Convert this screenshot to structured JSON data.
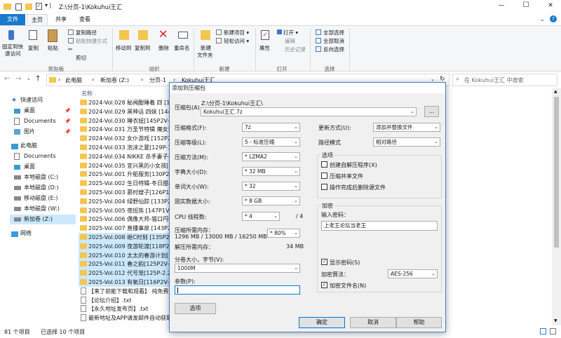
{
  "window": {
    "title": "Z:\\分页-1\\Kokuhui王汇",
    "minimize": "—",
    "maximize": "☐",
    "close": "✕"
  },
  "tabs": [
    {
      "label": "文件"
    },
    {
      "label": "主页"
    },
    {
      "label": "共享"
    },
    {
      "label": "查看"
    }
  ],
  "ribbon": {
    "pin_label_1": "固定到快",
    "pin_label_2": "速访问",
    "copy": "复制",
    "paste": "粘贴",
    "copy_path": "复制路径",
    "paste_shortcut": "粘贴快捷方式",
    "cut": "剪切",
    "move_to": "移动到",
    "copy_to": "复制到",
    "delete": "删除",
    "rename": "重命名",
    "new_folder_1": "新建",
    "new_folder_2": "文件夹",
    "new_item": "新建项目 ▾",
    "easy_access": "轻松访问 ▾",
    "properties": "属性",
    "open": "打开 ▾",
    "edit": "编辑",
    "history": "历史记录",
    "select_all": "全部选择",
    "select_none": "全部取消",
    "invert": "反向选择",
    "groups": {
      "clipboard": "剪贴板",
      "organize": "组织",
      "new": "新建",
      "open": "打开",
      "select": "选择"
    }
  },
  "address": {
    "crumbs": [
      "此电脑",
      "新加卷 (Z:)",
      "分页-1",
      "Kokuhui王汇"
    ],
    "search_placeholder": "在 Kokuhui王汇 中搜索"
  },
  "nav": {
    "quick_access": "快速访问",
    "desktop": "桌面",
    "documents": "Documents",
    "pictures": "图片",
    "this_pc": "此电脑",
    "pc_documents": "Documents",
    "pc_desktop": "桌面",
    "disk_c": "本地磁盘 (C:)",
    "disk_d": "本地磁盘 (D:)",
    "disk_e": "移动磁盘 (E:)",
    "disk_w": "本地磁盘 (W:)",
    "disk_z": "新加卷 (Z:)",
    "network": "网络"
  },
  "files": {
    "header": "名称",
    "rows": [
      {
        "name": "2024-Vol.028 秘闻酣睡着 四 [136"
      },
      {
        "name": "2024-Vol.029 黑神话 四妹 [144P2"
      },
      {
        "name": "2024-Vol.030 睡衣妞[145P2V-1.2"
      },
      {
        "name": "2024-Vol.031 万圣节特辑 魔女狂"
      },
      {
        "name": "2024-Vol.032 女仆游戏 [152P2V"
      },
      {
        "name": "2024-Vol.033 泡沫之夏[129P-1.3"
      },
      {
        "name": "2024-Vol.034 NIKKE 杀手妻子-光"
      },
      {
        "name": "2024-Vol.035 宜兴黑的小女孩[15"
      },
      {
        "name": "2025-Vol.001 升船服务[130P2V-"
      },
      {
        "name": "2025-Vol.002 生日特辑-冬日甜心"
      },
      {
        "name": "2025-Vol.003 慕时嫂子[126P1V-7"
      },
      {
        "name": "2025-Vol.004 绿野仙踪 [133P2V-"
      },
      {
        "name": "2025-Vol.005 夜班族 [147P1V-1."
      },
      {
        "name": "2025-Vol.006 偶像大师-猫口円香"
      },
      {
        "name": "2025-Vol.007 直播事故 [143P2V"
      },
      {
        "name": "2025-Vol.008 继C时刻 [135P2V-"
      },
      {
        "name": "2025-Vol.009 夜游轮渡[118P2V-"
      },
      {
        "name": "2025-Vol.010 太太的春游计划[13"
      },
      {
        "name": "2025-Vol.011 春之韵[125P2V-1.6"
      },
      {
        "name": "2025-Vol.012 代号笼[125P-2.26G"
      },
      {
        "name": "2025-Vol.013 有氧日[116P2V-2G"
      },
      {
        "name": "【来了就能下载和观看】 纯免费！"
      },
      {
        "name": "【论坛介绍】.txt"
      },
      {
        "name": "【永久地址发布页】.txt"
      },
      {
        "name": "最新地址及APP请发邮件自动获取"
      }
    ]
  },
  "status": {
    "count": "81 个项目",
    "selected": "已选择 10 个项目"
  },
  "dialog": {
    "title": "添加到压缩包",
    "archive_label": "压缩包(A)",
    "archive_path": "Z:\\分页-1\\Kokuhui王汇\\",
    "archive_name": "Kokuhui王汇.7z",
    "browse": "...",
    "format_label": "压缩格式(F):",
    "format_value": "7z",
    "level_label": "压缩等级(L):",
    "level_value": "5 - 标准压缩",
    "method_label": "压缩方法(M):",
    "method_value": "* LZMA2",
    "dict_label": "字典大小(D):",
    "dict_value": "* 32 MB",
    "word_label": "单词大小(W):",
    "word_value": "* 32",
    "solid_label": "固实数据大小:",
    "solid_value": "* 8 GB",
    "cpu_label": "CPU 线程数:",
    "cpu_value": "* 4",
    "cpu_total": "/ 4",
    "mem_comp_label": "压缩所需内存：",
    "mem_comp_value": "1296 MB / 13000 MB / 16250 MB",
    "mem_pct": "* 80%",
    "mem_decomp_label": "解压所需内存：",
    "mem_decomp_value": "34 MB",
    "split_label": "分卷大小，字节(V):",
    "split_value": "1000M",
    "params_label": "参数(P):",
    "params_value": "",
    "options_btn": "选项",
    "update_label": "更新方式(U):",
    "update_value": "添加并替换文件",
    "path_label": "路径模式",
    "path_value": "相对路径",
    "options_group": "选项",
    "opt_sfx": "创建自解压程序(X)",
    "opt_shared": "压缩共享文件",
    "opt_delete": "操作完成后删除源文件",
    "enc_group": "加密",
    "pwd_label": "输入密码：",
    "pwd_value": "上老王论坛当老王",
    "show_pwd": "显示密码(S)",
    "enc_method_label": "加密算法：",
    "enc_method_value": "AES-256",
    "enc_names": "加密文件名(N)",
    "ok": "确定",
    "cancel": "取消",
    "help": "帮助"
  },
  "colors": {
    "accent": "#1979ca",
    "selection": "#cce8ff",
    "dialog_bg": "#f0f0f0"
  }
}
